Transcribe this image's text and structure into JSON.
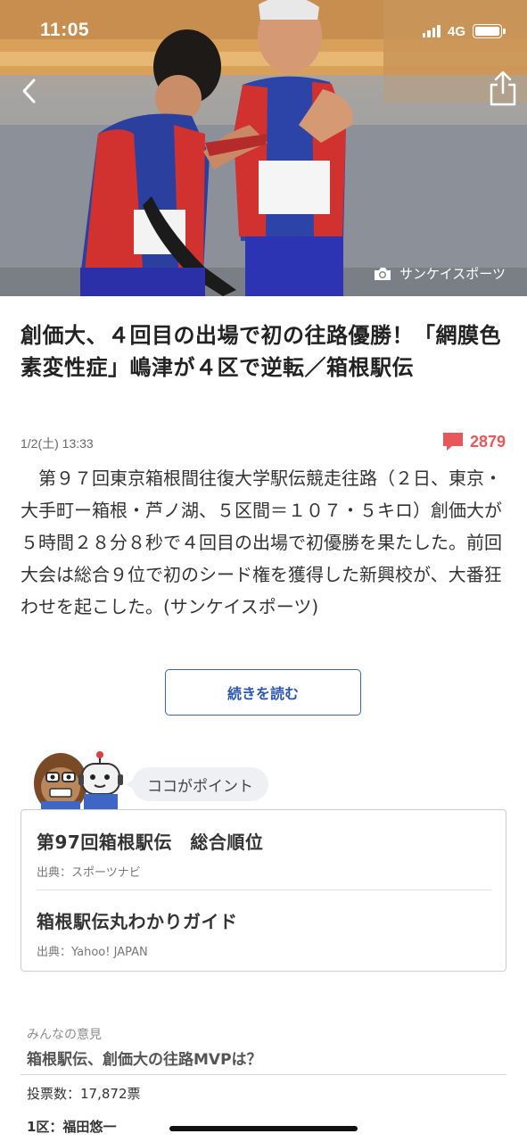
{
  "status_bar": {
    "time": "11:05",
    "network": "4G"
  },
  "hero": {
    "credit": "サンケイスポーツ"
  },
  "article": {
    "headline": "創価大、４回目の出場で初の往路優勝！「網膜色素変性症」嶋津が４区で逆転／箱根駅伝",
    "date": "1/2(土) 13:33",
    "comment_count": "2879",
    "body": "　第９７回東京箱根間往復大学駅伝競走往路（２日、東京・大手町ー箱根・芦ノ湖、５区間＝１０７・５キロ）創価大が５時間２８分８秒で４回目の出場で初優勝を果たした。前回大会は総合９位で初のシード権を獲得した新興校が、大番狂わせを起こした。(サンケイスポーツ)",
    "read_more": "続きを読む"
  },
  "point": {
    "label": "ココがポイント",
    "items": [
      {
        "title": "第97回箱根駅伝　総合順位",
        "source": "出典：スポーツナビ"
      },
      {
        "title": "箱根駅伝丸わかりガイド",
        "source": "出典：Yahoo! JAPAN"
      }
    ]
  },
  "opinion": {
    "label": "みんなの意見",
    "question": "箱根駅伝、創価大の往路MVPは？",
    "votes": "投票数：17,872票",
    "first_option": "1区：福田悠一"
  },
  "colors": {
    "accent_blue": "#2c58b0",
    "comment_red": "#e8585a"
  }
}
